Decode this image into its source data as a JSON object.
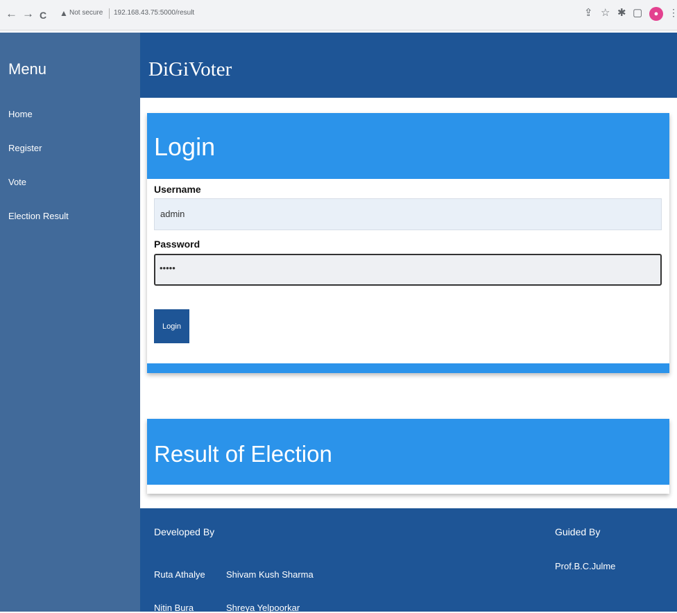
{
  "browser": {
    "back": "←",
    "forward": "→",
    "reload": "C",
    "security_label": "Not secure",
    "url": "192.168.43.75:5000/result"
  },
  "sidebar": {
    "title": "Menu",
    "items": [
      {
        "label": "Home"
      },
      {
        "label": "Register"
      },
      {
        "label": "Vote"
      },
      {
        "label": "Election Result"
      }
    ]
  },
  "header": {
    "brand": "DiGiVoter"
  },
  "login": {
    "title": "Login",
    "username_label": "Username",
    "username_value": "admin",
    "password_label": "Password",
    "password_value": "•••••",
    "button_label": "Login"
  },
  "result": {
    "title": "Result of Election"
  },
  "footer": {
    "developed_by": "Developed By",
    "developers": [
      "Ruta Athalye",
      "Shivam Kush Sharma",
      "Nitin Bura",
      "Shreya Yelpoorkar"
    ],
    "guided_by": "Guided By",
    "guide": "Prof.B.C.Julme"
  },
  "colors": {
    "sidebar": "#416a9a",
    "header": "#1e5596",
    "card_header": "#2b93ea"
  }
}
